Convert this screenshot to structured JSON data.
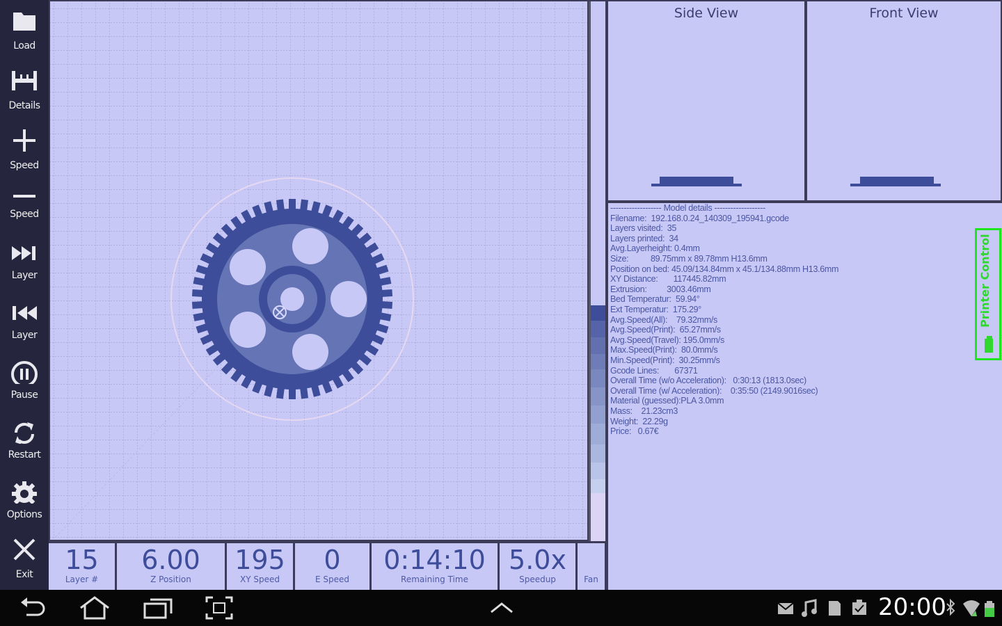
{
  "toolbar": {
    "items": [
      {
        "label": "Load",
        "icon": "folder-icon"
      },
      {
        "label": "Details",
        "icon": "ruler-icon"
      },
      {
        "label": "Speed",
        "icon": "plus-icon"
      },
      {
        "label": "Speed",
        "icon": "minus-icon"
      },
      {
        "label": "Layer",
        "icon": "skip-forward-icon"
      },
      {
        "label": "Layer",
        "icon": "skip-back-icon"
      },
      {
        "label": "Pause",
        "icon": "pause-icon"
      },
      {
        "label": "Restart",
        "icon": "restart-icon"
      },
      {
        "label": "Options",
        "icon": "gear-icon"
      },
      {
        "label": "Exit",
        "icon": "close-icon"
      }
    ]
  },
  "views": {
    "side_title": "Side View",
    "front_title": "Front View"
  },
  "status": {
    "cells": [
      {
        "value": "15",
        "caption": "Layer #"
      },
      {
        "value": "6.00",
        "caption": "Z Position"
      },
      {
        "value": "195",
        "caption": "XY Speed"
      },
      {
        "value": "0",
        "caption": "E Speed"
      },
      {
        "value": "0:14:10",
        "caption": "Remaining Time"
      },
      {
        "value": "5.0x",
        "caption": "Speedup"
      },
      {
        "value": "",
        "caption": "Fan"
      }
    ]
  },
  "details": {
    "lines": [
      "------------------- Model details -------------------",
      "Filename:  192.168.0.24_140309_195941.gcode",
      "Layers visited:  35",
      "Layers printed:  34",
      "Avg.Layerheight: 0.4mm",
      "Size:          89.75mm x 89.78mm H13.6mm",
      "Position on bed: 45.09/134.84mm x 45.1/134.88mm H13.6mm",
      "XY Distance:       117445.82mm",
      "Extrusion:         3003.46mm",
      "Bed Temperatur:  59.94°",
      "Ext Temperatur:  175.29°",
      "Avg.Speed(All):    79.32mm/s",
      "Avg.Speed(Print):  65.27mm/s",
      "Avg.Speed(Travel): 195.0mm/s",
      "Max.Speed(Print):  80.0mm/s",
      "Min.Speed(Print):  30.25mm/s",
      "Gcode Lines:       67371",
      "Overall Time (w/o Acceleration):   0:30:13 (1813.0sec)",
      "Overall Time (w/ Acceleration):    0:35:50 (2149.9016sec)",
      "Material (guessed):PLA 3.0mm",
      "Mass:    21.23cm3",
      "Weight:  22.29g",
      "Price:   0.67€"
    ]
  },
  "printer_control": {
    "label": "Printer Control",
    "icon": "printer-icon"
  },
  "layer_slider": {
    "current_layer": 15,
    "total_layers": 35
  },
  "system_bar": {
    "time": "20:00",
    "nav_icons": [
      "back-icon",
      "home-icon",
      "recent-apps-icon",
      "screenshot-icon",
      "expand-up-icon"
    ],
    "status_icons": [
      "mail-icon",
      "music-icon",
      "sd-card-icon",
      "clipboard-icon",
      "bluetooth-icon",
      "wifi-icon",
      "battery-icon"
    ]
  },
  "colors": {
    "background": "#c8c8f6",
    "model": "#3d4d9a",
    "toolbar": "#25253e",
    "printer_control": "#1ee61e"
  }
}
